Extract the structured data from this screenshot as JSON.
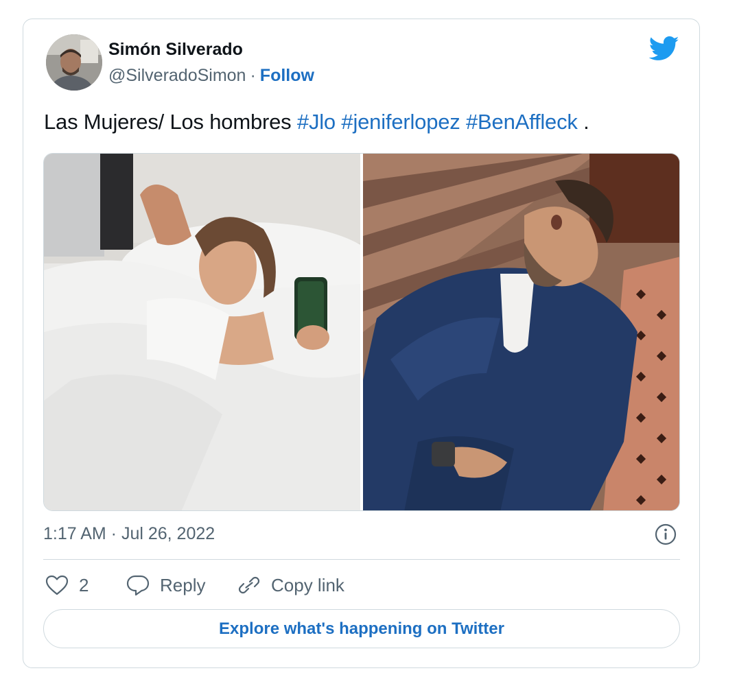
{
  "author": {
    "display_name": "Simón Silverado",
    "handle": "@SilveradoSimon",
    "separator": "·",
    "follow_label": "Follow"
  },
  "tweet": {
    "text_prefix": "Las Mujeres/ Los hombres",
    "hashtags": [
      "#Jlo",
      "#jeniferlopez",
      "#BenAffleck"
    ],
    "text_suffix": "."
  },
  "media": {
    "photos": [
      "woman-in-bed-photo",
      "man-sunbathing-photo"
    ]
  },
  "meta": {
    "timestamp": "1:17 AM · Jul 26, 2022"
  },
  "actions": {
    "like_count": "2",
    "reply_label": "Reply",
    "copy_link_label": "Copy link"
  },
  "footer": {
    "explore_label": "Explore what's happening on Twitter"
  },
  "colors": {
    "accent": "#1d6fc2",
    "text_primary": "#0f1419",
    "text_secondary": "#536471",
    "border": "#cfd9de",
    "twitter_blue": "#1d9bf0"
  }
}
